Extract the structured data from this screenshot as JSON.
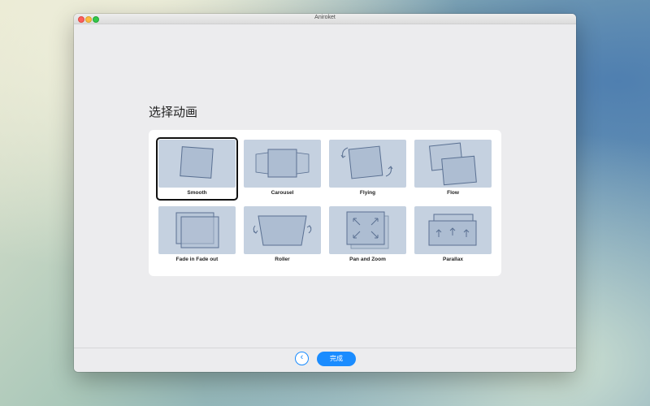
{
  "window": {
    "title": "Aniroket"
  },
  "heading": "选择动画",
  "animations": [
    {
      "label": "Smooth",
      "icon": "smooth-icon",
      "selected": true
    },
    {
      "label": "Carousel",
      "icon": "carousel-icon",
      "selected": false
    },
    {
      "label": "Flying",
      "icon": "flying-icon",
      "selected": false
    },
    {
      "label": "Flow",
      "icon": "flow-icon",
      "selected": false
    },
    {
      "label": "Fade in Fade out",
      "icon": "fade-icon",
      "selected": false
    },
    {
      "label": "Roller",
      "icon": "roller-icon",
      "selected": false
    },
    {
      "label": "Pan and Zoom",
      "icon": "pan-zoom-icon",
      "selected": false
    },
    {
      "label": "Parallax",
      "icon": "parallax-icon",
      "selected": false
    }
  ],
  "footer": {
    "back_icon": "‹",
    "done_label": "完成"
  },
  "colors": {
    "accent": "#1a8cff",
    "thumb_bg": "#c5d1e0",
    "shape_stroke": "#5a7092"
  }
}
